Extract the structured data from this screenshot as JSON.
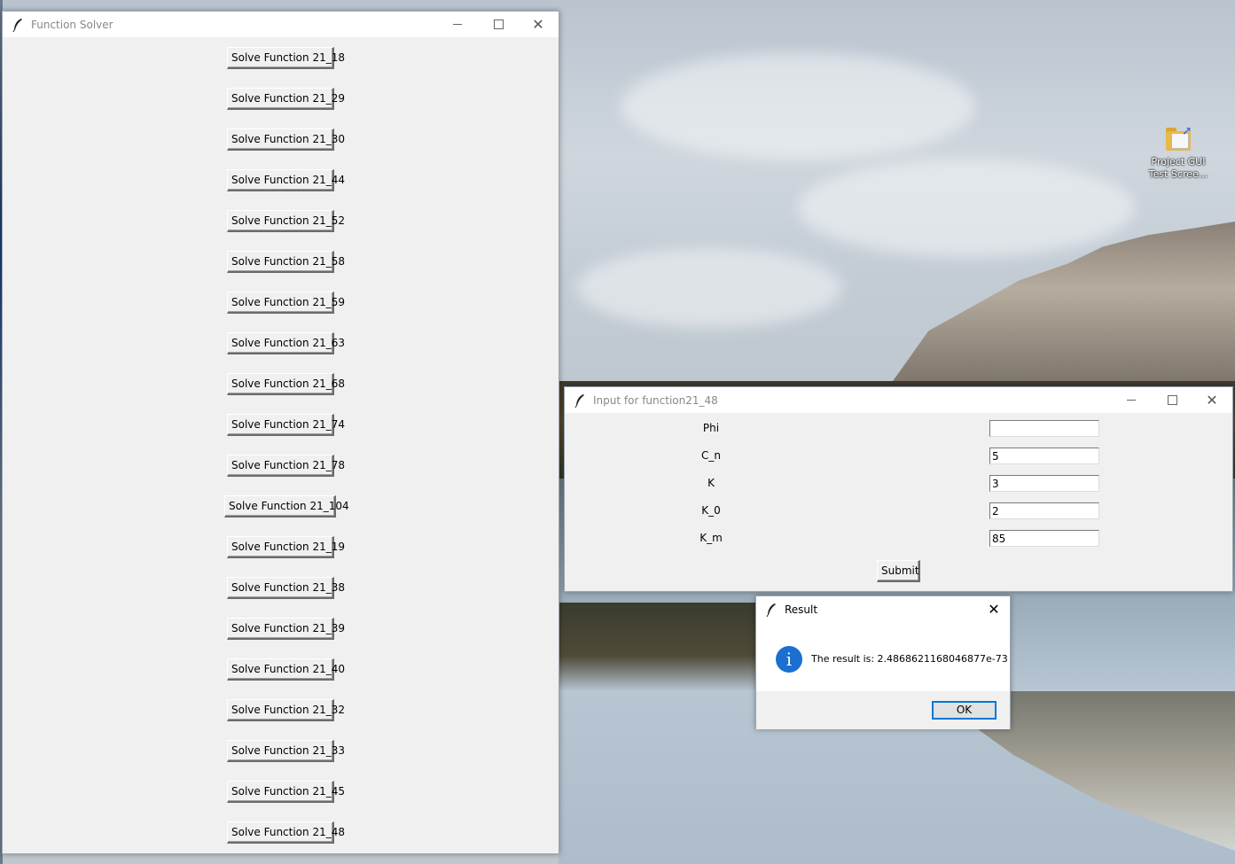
{
  "desktop": {
    "icon": {
      "name": "folder-icon",
      "label": "Project GUI\nTest Scree..."
    }
  },
  "solver_window": {
    "title": "Function Solver",
    "buttons": [
      "Solve Function 21_18",
      "Solve Function 21_29",
      "Solve Function 21_30",
      "Solve Function 21_44",
      "Solve Function 21_52",
      "Solve Function 21_58",
      "Solve Function 21_59",
      "Solve Function 21_63",
      "Solve Function 21_68",
      "Solve Function 21_74",
      "Solve Function 21_78",
      "Solve Function 21_104",
      "Solve Function 21_19",
      "Solve Function 21_38",
      "Solve Function 21_39",
      "Solve Function 21_40",
      "Solve Function 21_32",
      "Solve Function 21_33",
      "Solve Function 21_45",
      "Solve Function 21_48"
    ]
  },
  "input_window": {
    "title": "Input for function21_48",
    "fields": [
      {
        "label": "Phi",
        "value": ""
      },
      {
        "label": "C_n",
        "value": "5"
      },
      {
        "label": "K",
        "value": "3"
      },
      {
        "label": "K_0",
        "value": "2"
      },
      {
        "label": "K_m",
        "value": "85"
      }
    ],
    "submit_label": "Submit"
  },
  "result_dialog": {
    "title": "Result",
    "message": "The result is: 2.4868621168046877e-73",
    "ok_label": "OK",
    "icon": "info-icon"
  },
  "colors": {
    "accent": "#0078d7",
    "info": "#1a6fd1",
    "window_bg": "#f0f0f0"
  }
}
